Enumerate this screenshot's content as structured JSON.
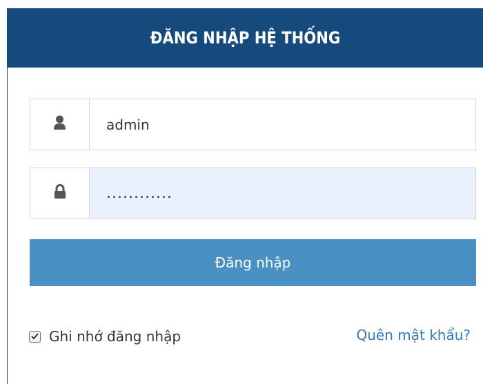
{
  "colors": {
    "header_bg": "#174a7c",
    "button_bg": "#4a90c2",
    "link": "#3579b8",
    "password_bg": "#e9f0fe"
  },
  "header": {
    "title": "ĐĂNG NHẬP HỆ THỐNG"
  },
  "form": {
    "username": {
      "icon": "user-icon",
      "value": "admin"
    },
    "password": {
      "icon": "lock-icon",
      "value": "............"
    },
    "submit_label": "Đăng nhập",
    "remember": {
      "label": "Ghi nhớ đăng nhập",
      "checked": true
    },
    "forgot_label": "Quên mật khẩu?"
  }
}
